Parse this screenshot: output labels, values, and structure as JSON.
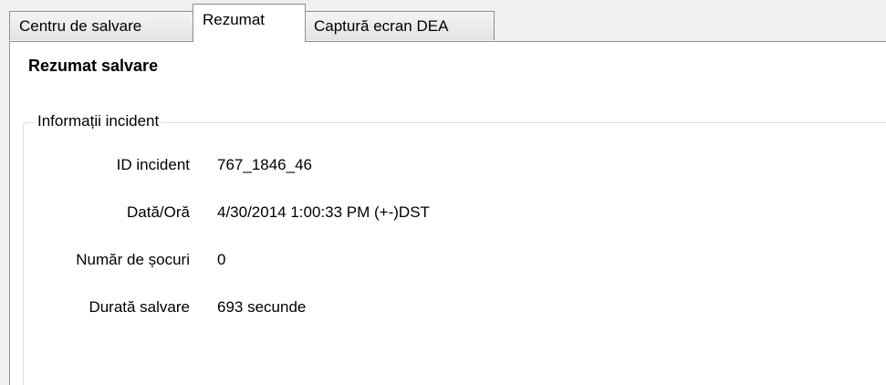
{
  "tabs": [
    {
      "label": "Centru de salvare",
      "active": false
    },
    {
      "label": "Rezumat",
      "active": true
    },
    {
      "label": "Captură ecran DEA",
      "active": false
    }
  ],
  "panel": {
    "title": "Rezumat salvare",
    "group": {
      "legend": "Informații incident",
      "fields": [
        {
          "label": "ID incident",
          "value": "767_1846_46"
        },
        {
          "label": "Dată/Oră",
          "value": "4/30/2014 1:00:33 PM (+-)DST"
        },
        {
          "label": "Număr de șocuri",
          "value": "0"
        },
        {
          "label": "Durată salvare",
          "value": "693 secunde"
        }
      ]
    }
  }
}
